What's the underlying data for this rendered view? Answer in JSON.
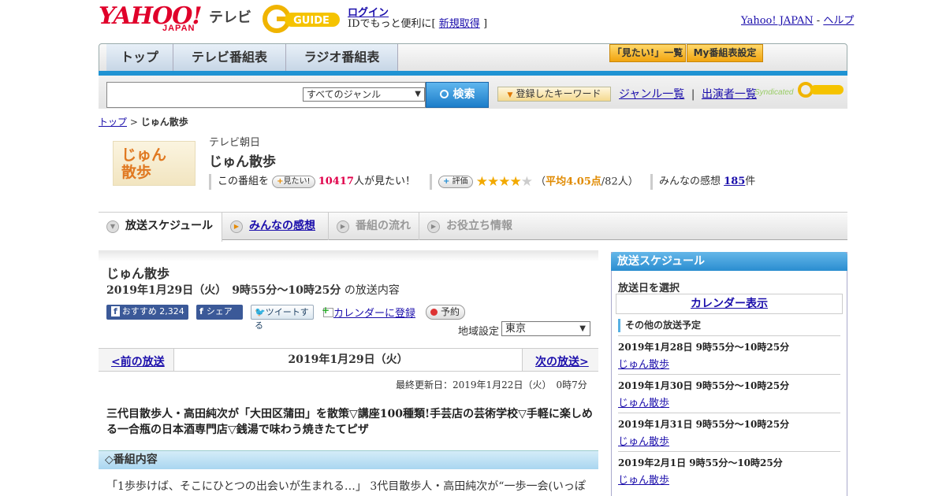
{
  "header": {
    "logo_text": "YAHOO!",
    "logo_sub": "JAPAN",
    "tv_label": "テレビ",
    "gguide_logo": "G GUIDE",
    "login": "ログイン",
    "id_note_prefix": "IDでもっと便利に[",
    "signup": "新規取得",
    "id_note_suffix": "]",
    "yahoo_japan": "Yahoo! JAPAN",
    "sep": "-",
    "help": "ヘルプ"
  },
  "nav": {
    "tabs": [
      {
        "label": "トップ"
      },
      {
        "label": "テレビ番組表"
      },
      {
        "label": "ラジオ番組表"
      }
    ],
    "mitai_list": "「見たい!」一覧",
    "my_schedule": "My番組表設定"
  },
  "search": {
    "genre": "すべてのジャンル",
    "button": "検索",
    "keyword_button": "登録したキーワード",
    "genre_list": "ジャンル一覧",
    "divider": "|",
    "performer_list": "出演者一覧",
    "syndicated": "Syndicated"
  },
  "breadcrumb": {
    "top": "トップ",
    "sep": ">",
    "current": "じゅん散歩"
  },
  "program": {
    "logo_text": "じゅん散歩",
    "channel": "テレビ朝日",
    "title": "じゅん散歩",
    "want_prefix": "この番組を",
    "want_button": "見たい!",
    "want_count": "10417",
    "want_suffix": "人が見たい！",
    "rate_button": "評価",
    "rating": 4.05,
    "avg_prefix": "（",
    "avg_text": "平均4.05点",
    "avg_suffix": "/82人）",
    "kansou_prefix": "みんなの感想",
    "kansou_count": "185",
    "kansou_suffix": "件"
  },
  "subtabs": [
    {
      "label": "放送スケジュール",
      "state": "active"
    },
    {
      "label": "みんなの感想",
      "state": "link"
    },
    {
      "label": "番組の流れ",
      "state": "disabled"
    },
    {
      "label": "お役立ち情報",
      "state": "disabled"
    }
  ],
  "main": {
    "title": "じゅん散歩",
    "date_time": "2019年1月29日（火）　9時55分～10時25分",
    "date_suffix": "の放送内容",
    "fb_recommend": "おすすめ",
    "fb_count": "2,324",
    "fb_share": "シェア",
    "tweet": "ツイートする",
    "calendar_register": "カレンダーに登録",
    "reserve": "予約",
    "region_label": "地域設定",
    "region_value": "東京",
    "prev": "<前の放送",
    "current_date": "2019年1月29日（火）",
    "next": "次の放送>",
    "updated": "最終更新日：2019年1月22日（火）　0時7分",
    "summary": "三代目散歩人・高田純次が「大田区蒲田」を散策▽講座100種類!手芸店の芸術学校▽手軽に楽しめる一合瓶の日本酒専門店▽銭湯で味わう焼きたてピザ",
    "section_title": "◇番組内容",
    "section_body": "「1歩歩けば、そこにひとつの出会いが生まれる…」 3代目散歩人・高田純次が“一歩一会(いっぽ"
  },
  "sidebar": {
    "title": "放送スケジュール",
    "select_label": "放送日を選択",
    "calendar": "カレンダー表示",
    "other_label": "その他の放送予定",
    "items": [
      {
        "date": "2019年1月28日  9時55分～10時25分",
        "title": "じゅん散歩"
      },
      {
        "date": "2019年1月30日  9時55分～10時25分",
        "title": "じゅん散歩"
      },
      {
        "date": "2019年1月31日  9時55分～10時25分",
        "title": "じゅん散歩"
      },
      {
        "date": "2019年2月1日  9時55分～10時25分",
        "title": "じゅん散歩"
      }
    ]
  },
  "colors": {
    "accent_blue": "#1f93d3",
    "yahoo_red": "#e0002a",
    "star": "#f2a900"
  }
}
